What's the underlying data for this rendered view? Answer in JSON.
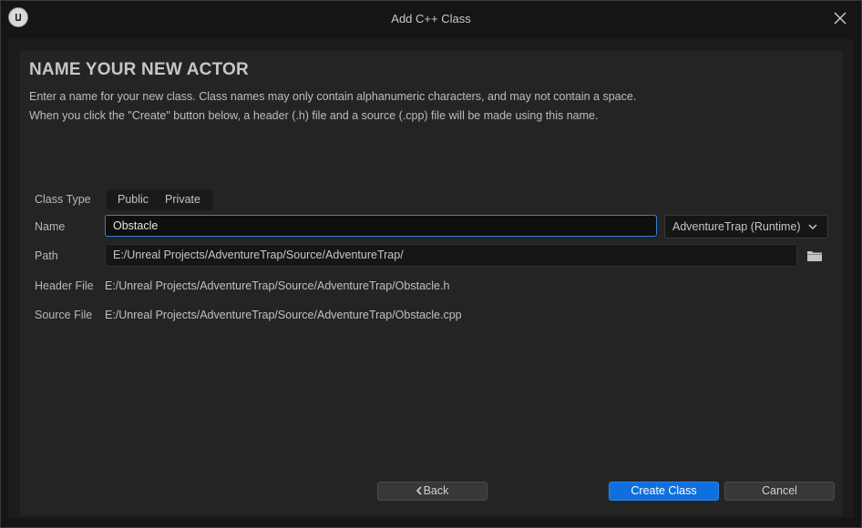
{
  "window": {
    "title": "Add C++ Class"
  },
  "header": {
    "heading": "NAME YOUR NEW ACTOR",
    "description_line1": "Enter a name for your new class. Class names may only contain alphanumeric characters, and may not contain a space.",
    "description_line2": "When you click the \"Create\" button below, a header (.h) file and a source (.cpp) file will be made using this name."
  },
  "form": {
    "class_type_label": "Class Type",
    "class_type_options": [
      "Public",
      "Private"
    ],
    "name_label": "Name",
    "name_value": "Obstacle",
    "module_value": "AdventureTrap (Runtime)",
    "path_label": "Path",
    "path_value": "E:/Unreal Projects/AdventureTrap/Source/AdventureTrap/",
    "header_file_label": "Header File",
    "header_file_value": "E:/Unreal Projects/AdventureTrap/Source/AdventureTrap/Obstacle.h",
    "source_file_label": "Source File",
    "source_file_value": "E:/Unreal Projects/AdventureTrap/Source/AdventureTrap/Obstacle.cpp"
  },
  "footer": {
    "back_label": "Back",
    "create_label": "Create Class",
    "cancel_label": "Cancel"
  },
  "icons": {
    "app_logo": "unreal-logo-icon",
    "close": "close-icon",
    "dropdown": "chevron-down-icon",
    "browse": "folder-icon",
    "back": "chevron-left-icon"
  },
  "colors": {
    "accent": "#0f6fdc",
    "focus_border": "#2f7fd8",
    "panel": "#242424",
    "background": "#151515"
  }
}
